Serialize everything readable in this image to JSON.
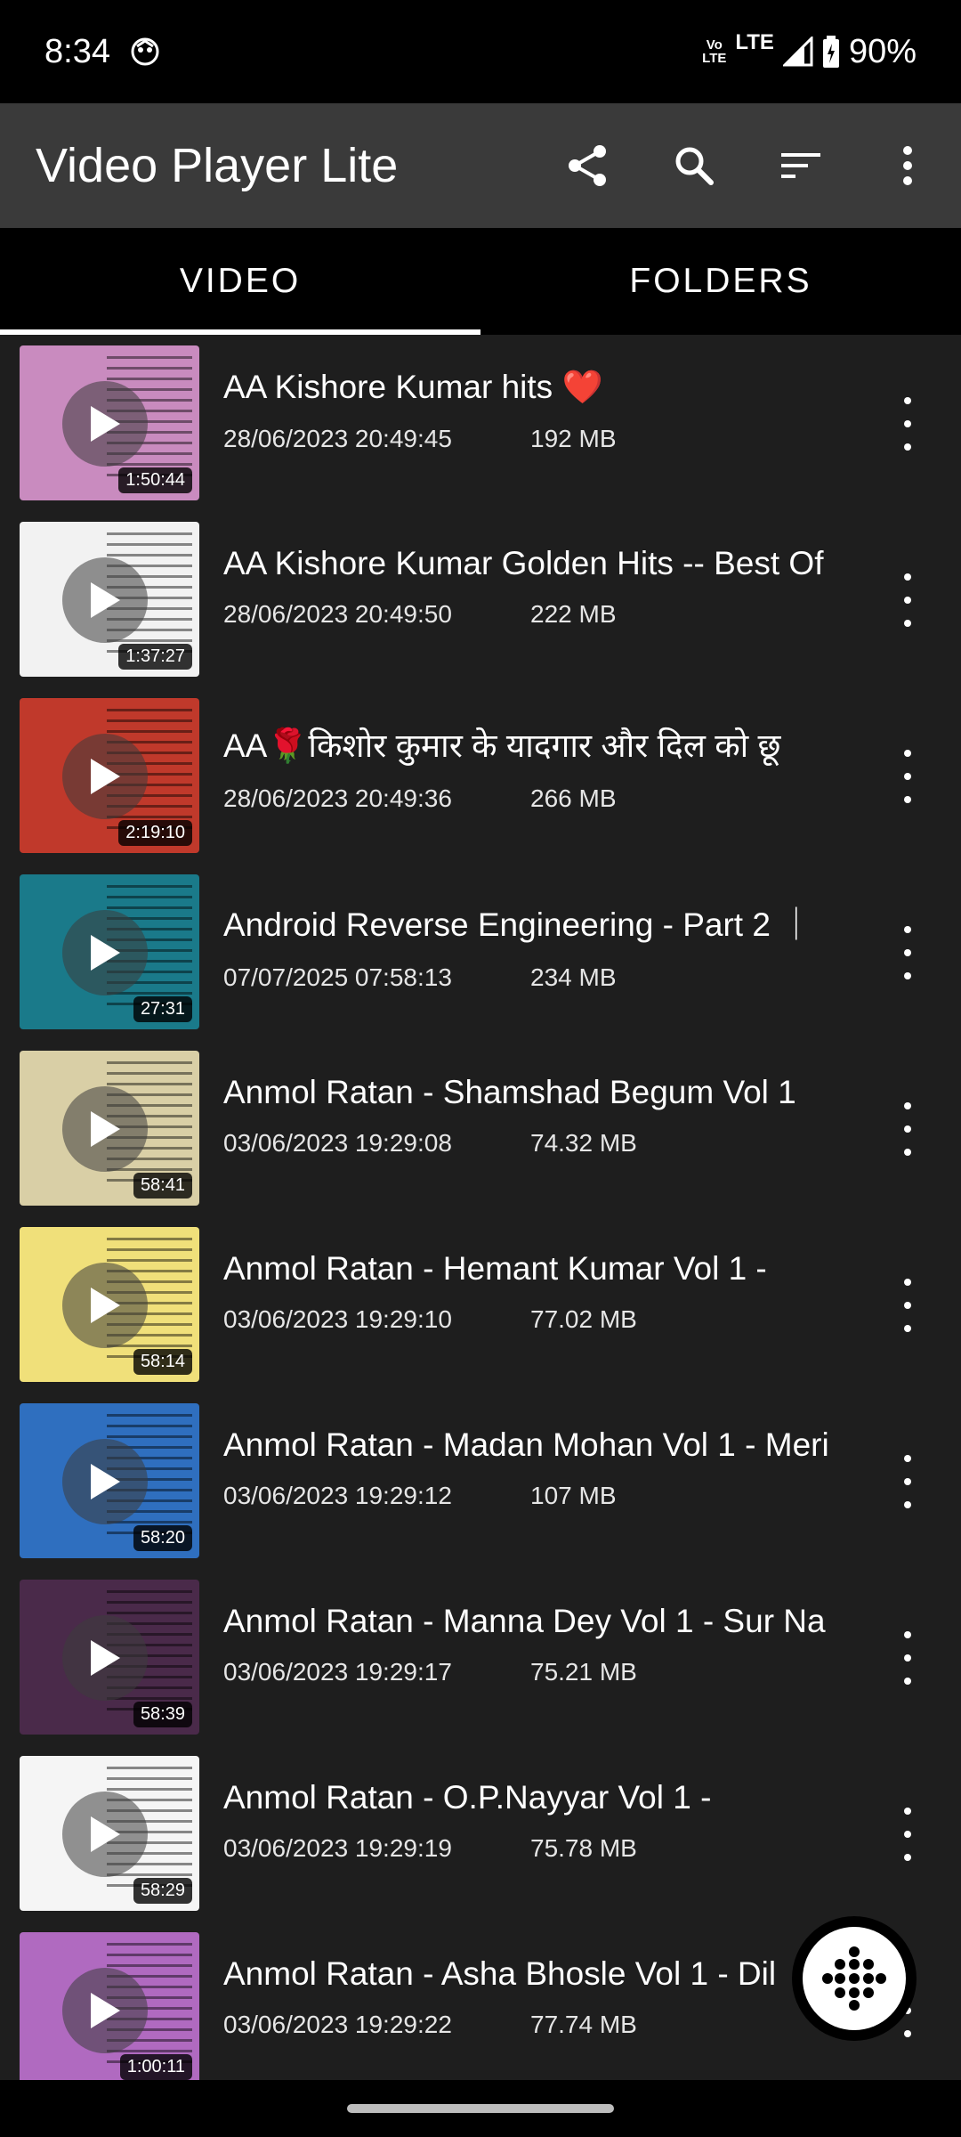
{
  "status_bar": {
    "time": "8:34",
    "network_volte": "Vo\nLTE",
    "network_lte": "LTE",
    "battery": "90%"
  },
  "app_bar": {
    "title": "Video Player Lite",
    "actions": [
      "share-icon",
      "search-icon",
      "sort-icon",
      "more-vert-icon"
    ]
  },
  "tabs": [
    {
      "label": "VIDEO",
      "active": true
    },
    {
      "label": "FOLDERS",
      "active": false
    }
  ],
  "videos": [
    {
      "title": "AA  Kishore Kumar hits ❤️",
      "date": "28/06/2023 20:49:45",
      "size": "192 MB",
      "duration": "1:50:44",
      "thumb_color": "#c98bbf"
    },
    {
      "title": "AA Kishore Kumar Golden Hits -- Best Of",
      "date": "28/06/2023 20:49:50",
      "size": "222 MB",
      "duration": "1:37:27",
      "thumb_color": "#f2f2f2"
    },
    {
      "title": "AA🌹किशोर कुमार के यादगार और दिल को छू",
      "date": "28/06/2023 20:49:36",
      "size": "266 MB",
      "duration": "2:19:10",
      "thumb_color": "#c0392b"
    },
    {
      "title": "Android Reverse Engineering - Part 2 ｜",
      "date": "07/07/2025 07:58:13",
      "size": "234 MB",
      "duration": "27:31",
      "thumb_color": "#1a7a8a"
    },
    {
      "title": "Anmol Ratan  - Shamshad Begum Vol 1",
      "date": "03/06/2023 19:29:08",
      "size": "74.32 MB",
      "duration": "58:41",
      "thumb_color": "#d9cfa6"
    },
    {
      "title": "Anmol Ratan -  Hemant Kumar Vol 1 -",
      "date": "03/06/2023 19:29:10",
      "size": "77.02 MB",
      "duration": "58:14",
      "thumb_color": "#f0e07a"
    },
    {
      "title": "Anmol Ratan -  Madan Mohan Vol 1 - Meri",
      "date": "03/06/2023 19:29:12",
      "size": "107 MB",
      "duration": "58:20",
      "thumb_color": "#2f6fbf"
    },
    {
      "title": "Anmol Ratan -  Manna Dey Vol 1 - Sur Na",
      "date": "03/06/2023 19:29:17",
      "size": "75.21 MB",
      "duration": "58:39",
      "thumb_color": "#4a2a4a"
    },
    {
      "title": "Anmol Ratan -  O.P.Nayyar Vol 1 -",
      "date": "03/06/2023 19:29:19",
      "size": "75.78 MB",
      "duration": "58:29",
      "thumb_color": "#f5f5f5"
    },
    {
      "title": "Anmol Ratan - Asha Bhosle Vol 1 - Dil",
      "date": "03/06/2023 19:29:22",
      "size": "77.74 MB",
      "duration": "1:00:11",
      "thumb_color": "#b06ac0"
    }
  ],
  "fab": {
    "icon": "dial-grid-icon"
  }
}
